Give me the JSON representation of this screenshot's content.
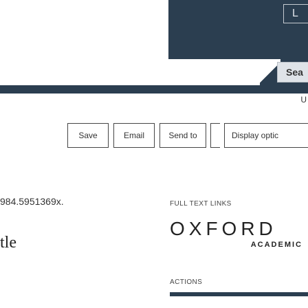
{
  "header": {
    "login_label": "L",
    "search_button_label": "Sea",
    "user_link": "U"
  },
  "toolbar": {
    "items": [
      {
        "label": "Save"
      },
      {
        "label": "Email"
      },
      {
        "label": "Send to"
      },
      {
        "label": ""
      },
      {
        "label": "Display optic"
      }
    ]
  },
  "article": {
    "doi_fragment": "984.5951369x.",
    "title_fragment": "tle"
  },
  "sidebar": {
    "full_text_heading": "FULL TEXT LINKS",
    "provider_logo": {
      "name": "OXFORD",
      "subtitle": "ACADEMIC"
    },
    "actions_heading": "ACTIONS"
  },
  "colors": {
    "brand_dark": "#2b3e50",
    "border": "#444444"
  }
}
